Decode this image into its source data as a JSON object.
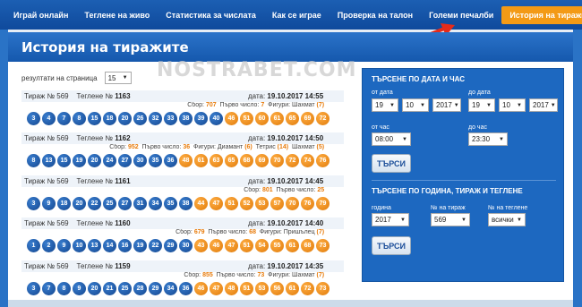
{
  "nav": {
    "items": [
      "Играй онлайн",
      "Теглене на живо",
      "Статистика за числата",
      "Как се играе",
      "Проверка на талон",
      "Големи печалби",
      "История на тиражите"
    ],
    "active": 6
  },
  "page_title": "История на тиражите",
  "watermark": "NOSTRABET.COM",
  "per_page": {
    "label": "резултати на страница",
    "value": "15"
  },
  "draws": [
    {
      "tiraj": "Тираж № 569",
      "teglene": "Теглене №",
      "num": "1163",
      "date_label": "дата:",
      "date": "19.10.2017 14:55",
      "meta": [
        [
          "Сбор:",
          "707"
        ],
        [
          "Първо число:",
          "7"
        ],
        [
          "Фигури: Шахмат",
          "(7)"
        ]
      ],
      "balls": [
        3,
        4,
        7,
        8,
        15,
        18,
        20,
        26,
        32,
        33,
        38,
        39,
        40,
        46,
        51,
        60,
        61,
        65,
        69,
        72
      ],
      "orange_from": 13
    },
    {
      "tiraj": "Тираж № 569",
      "teglene": "Теглене №",
      "num": "1162",
      "date_label": "дата:",
      "date": "19.10.2017 14:50",
      "meta": [
        [
          "Сбор:",
          "952"
        ],
        [
          "Първо число:",
          "36"
        ],
        [
          "Фигури: Диамант",
          "(6)"
        ],
        [
          "Тетрис",
          "(14)"
        ],
        [
          "Шахмат",
          "(5)"
        ]
      ],
      "balls": [
        8,
        13,
        15,
        19,
        20,
        24,
        27,
        30,
        35,
        36,
        48,
        61,
        63,
        65,
        68,
        69,
        70,
        72,
        74,
        76
      ],
      "orange_from": 10
    },
    {
      "tiraj": "Тираж № 569",
      "teglene": "Теглене №",
      "num": "1161",
      "date_label": "дата:",
      "date": "19.10.2017 14:45",
      "meta": [
        [
          "Сбор:",
          "801"
        ],
        [
          "Първо число:",
          "25"
        ]
      ],
      "balls": [
        3,
        9,
        18,
        20,
        22,
        25,
        27,
        31,
        34,
        35,
        38,
        44,
        47,
        51,
        52,
        53,
        57,
        70,
        76,
        79
      ],
      "orange_from": 11
    },
    {
      "tiraj": "Тираж № 569",
      "teglene": "Теглене №",
      "num": "1160",
      "date_label": "дата:",
      "date": "19.10.2017 14:40",
      "meta": [
        [
          "Сбор:",
          "679"
        ],
        [
          "Първо число:",
          "68"
        ],
        [
          "Фигури: Пришълец",
          "(7)"
        ]
      ],
      "balls": [
        1,
        2,
        9,
        10,
        13,
        14,
        16,
        19,
        22,
        29,
        30,
        43,
        46,
        47,
        51,
        54,
        55,
        61,
        68,
        73
      ],
      "orange_from": 11
    },
    {
      "tiraj": "Тираж № 569",
      "teglene": "Теглене №",
      "num": "1159",
      "date_label": "дата:",
      "date": "19.10.2017 14:35",
      "meta": [
        [
          "Сбор:",
          "855"
        ],
        [
          "Първо число:",
          "73"
        ],
        [
          "Фигури: Шахмат",
          "(7)"
        ]
      ],
      "balls": [
        3,
        7,
        8,
        9,
        20,
        21,
        25,
        28,
        29,
        34,
        36,
        46,
        47,
        48,
        51,
        53,
        56,
        61,
        72,
        73
      ],
      "orange_from": 11
    }
  ],
  "search_date": {
    "title": "ТЪРСЕНЕ ПО ДАТА И ЧАС",
    "from_date_label": "от дата",
    "to_date_label": "до дата",
    "from_day": "19",
    "from_month": "10",
    "from_year": "2017",
    "to_day": "19",
    "to_month": "10",
    "to_year": "2017",
    "from_time_label": "от час",
    "to_time_label": "до час",
    "from_time": "08:00",
    "to_time": "23:30",
    "button": "ТЪРСИ"
  },
  "search_year": {
    "title": "ТЪРСЕНЕ ПО ГОДИНА, ТИРАЖ И ТЕГЛЕНЕ",
    "year_label": "година",
    "tiraj_label": "№ на тираж",
    "teglene_label": "№ на теглене",
    "year": "2017",
    "tiraj": "569",
    "teglene": "всички",
    "button": "ТЪРСИ"
  },
  "colors": {
    "nav_bg": "#1558ad",
    "active_tab": "#f39a16",
    "ball_blue": "#13458e",
    "ball_orange": "#e07a08"
  }
}
